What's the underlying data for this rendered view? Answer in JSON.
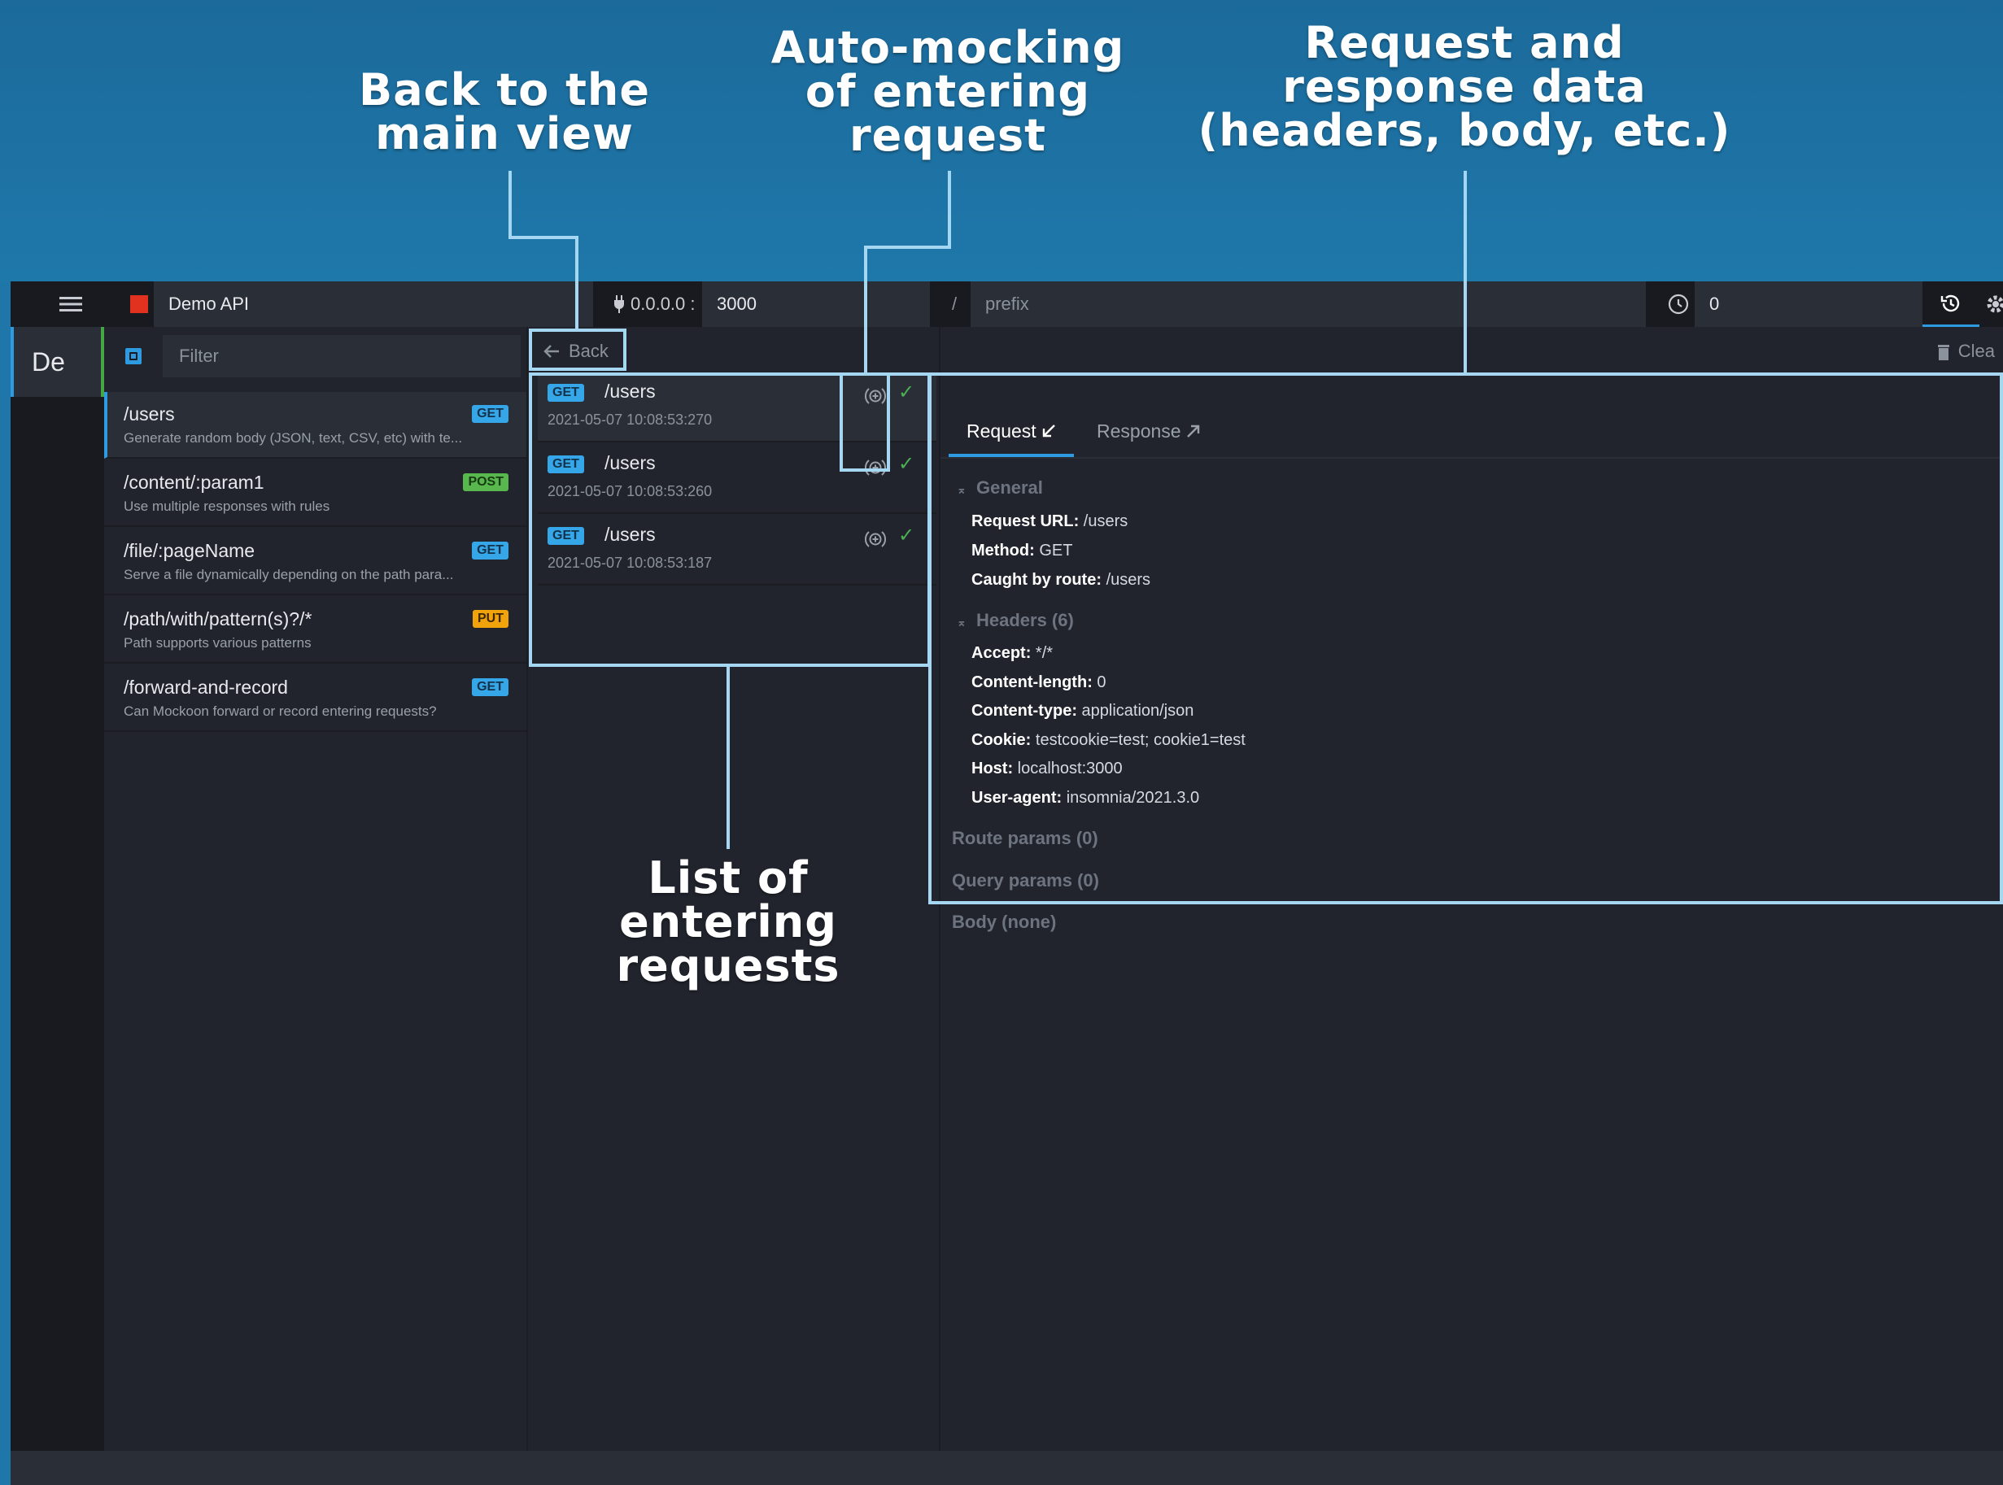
{
  "callouts": {
    "back": [
      "Back to the",
      "main view"
    ],
    "mocking": [
      "Auto-mocking",
      "of entering",
      "request"
    ],
    "data": [
      "Request and",
      "response data",
      "(headers, body, etc.)"
    ],
    "list": [
      "List of",
      "entering",
      "requests"
    ]
  },
  "colors": {
    "banner": "#1f76a8",
    "annotation": "#a5d6f2",
    "accent": "#2e9be0",
    "get": "#35a6e8",
    "post": "#58b84e",
    "put": "#f0a30a",
    "stop": "#e0321f"
  },
  "topbar": {
    "menu_icon": "hamburger-icon",
    "env_name": "Demo API",
    "host": "0.0.0.0 :",
    "port": "3000",
    "slash": "/",
    "prefix_placeholder": "prefix",
    "latency": "0",
    "clear_label": "Clea"
  },
  "env_rail": {
    "abbrev": "De"
  },
  "routes": {
    "filter_placeholder": "Filter",
    "items": [
      {
        "path": "/users",
        "method": "GET",
        "desc": "Generate random body (JSON, text, CSV, etc) with te..."
      },
      {
        "path": "/content/:param1",
        "method": "POST",
        "desc": "Use multiple responses with rules"
      },
      {
        "path": "/file/:pageName",
        "method": "GET",
        "desc": "Serve a file dynamically depending on the path para..."
      },
      {
        "path": "/path/with/pattern(s)?/*",
        "method": "PUT",
        "desc": "Path supports various patterns"
      },
      {
        "path": "/forward-and-record",
        "method": "GET",
        "desc": "Can Mockoon forward or record entering requests?"
      }
    ]
  },
  "logs": {
    "back_label": "Back",
    "items": [
      {
        "method": "GET",
        "path": "/users",
        "time": "2021-05-07 10:08:53:270"
      },
      {
        "method": "GET",
        "path": "/users",
        "time": "2021-05-07 10:08:53:260"
      },
      {
        "method": "GET",
        "path": "/users",
        "time": "2021-05-07 10:08:53:187"
      }
    ]
  },
  "detail": {
    "tabs": [
      "Request",
      "Response"
    ],
    "general_title": "General",
    "general": [
      {
        "key": "Request URL:",
        "value": "/users"
      },
      {
        "key": "Method:",
        "value": "GET"
      },
      {
        "key": "Caught by route:",
        "value": "/users"
      }
    ],
    "headers_title": "Headers (6)",
    "headers": [
      {
        "key": "Accept:",
        "value": "*/*"
      },
      {
        "key": "Content-length:",
        "value": "0"
      },
      {
        "key": "Content-type:",
        "value": "application/json"
      },
      {
        "key": "Cookie:",
        "value": "testcookie=test; cookie1=test"
      },
      {
        "key": "Host:",
        "value": "localhost:3000"
      },
      {
        "key": "User-agent:",
        "value": "insomnia/2021.3.0"
      }
    ],
    "route_params": "Route params (0)",
    "query_params": "Query params (0)",
    "body": "Body (none)"
  }
}
